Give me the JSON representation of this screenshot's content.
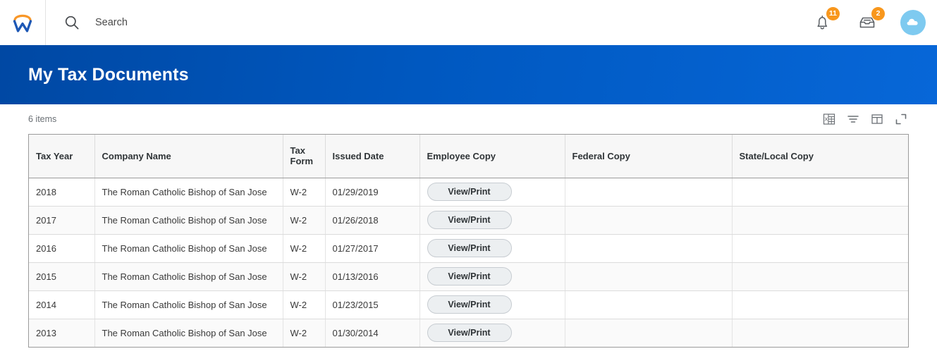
{
  "header": {
    "logo_alt": "Workday",
    "search": {
      "placeholder": "Search",
      "value": ""
    },
    "notifications": {
      "icon": "bell-icon",
      "badge_count": "11"
    },
    "inbox": {
      "icon": "inbox-icon",
      "badge_count": "2"
    },
    "avatar": {
      "icon": "cloud-icon"
    }
  },
  "banner": {
    "title": "My Tax Documents"
  },
  "grid_toolbar": {
    "item_count": "6 items",
    "icons": [
      {
        "name": "export-to-excel-icon",
        "label": "Export to Excel"
      },
      {
        "name": "filter-icon",
        "label": "Filter"
      },
      {
        "name": "grid-view-icon",
        "label": "Toggle Grid"
      },
      {
        "name": "expand-icon",
        "label": "View Full Screen"
      }
    ]
  },
  "table": {
    "columns": [
      "Tax Year",
      "Tax Form",
      "Company Name",
      "Issued Date",
      "Employee Copy",
      "Federal Copy",
      "State/Local Copy"
    ],
    "headers": {
      "tax_year": "Tax Year",
      "company_name": "Company Name",
      "tax_form": "Tax Form",
      "tax_form_line1": "Tax",
      "tax_form_line2": "Form",
      "issued_date": "Issued Date",
      "employee_copy": "Employee Copy",
      "federal_copy": "Federal Copy",
      "state_local_copy": "State/Local Copy"
    },
    "rows": [
      {
        "tax_year": "2018",
        "company_name": "The Roman Catholic Bishop of San Jose",
        "tax_form": "W-2",
        "issued_date": "01/29/2019",
        "employee_copy": "View/Print",
        "federal_copy": "",
        "state_local_copy": ""
      },
      {
        "tax_year": "2017",
        "company_name": "The Roman Catholic Bishop of San Jose",
        "tax_form": "W-2",
        "issued_date": "01/26/2018",
        "employee_copy": "View/Print",
        "federal_copy": "",
        "state_local_copy": ""
      },
      {
        "tax_year": "2016",
        "company_name": "The Roman Catholic Bishop of San Jose",
        "tax_form": "W-2",
        "issued_date": "01/27/2017",
        "employee_copy": "View/Print",
        "federal_copy": "",
        "state_local_copy": ""
      },
      {
        "tax_year": "2015",
        "company_name": "The Roman Catholic Bishop of San Jose",
        "tax_form": "W-2",
        "issued_date": "01/13/2016",
        "employee_copy": "View/Print",
        "federal_copy": "",
        "state_local_copy": ""
      },
      {
        "tax_year": "2014",
        "company_name": "The Roman Catholic Bishop of San Jose",
        "tax_form": "W-2",
        "issued_date": "01/23/2015",
        "employee_copy": "View/Print",
        "federal_copy": "",
        "state_local_copy": ""
      },
      {
        "tax_year": "2013",
        "company_name": "The Roman Catholic Bishop of San Jose",
        "tax_form": "W-2",
        "issued_date": "01/30/2014",
        "employee_copy": "View/Print",
        "federal_copy": "",
        "state_local_copy": ""
      }
    ]
  },
  "colors": {
    "brand_blue": "#0058c0",
    "logo_blue": "#1c57b5",
    "logo_orange": "#f89728",
    "badge_orange": "#f8971d",
    "avatar_blue": "#7ecaf0"
  }
}
